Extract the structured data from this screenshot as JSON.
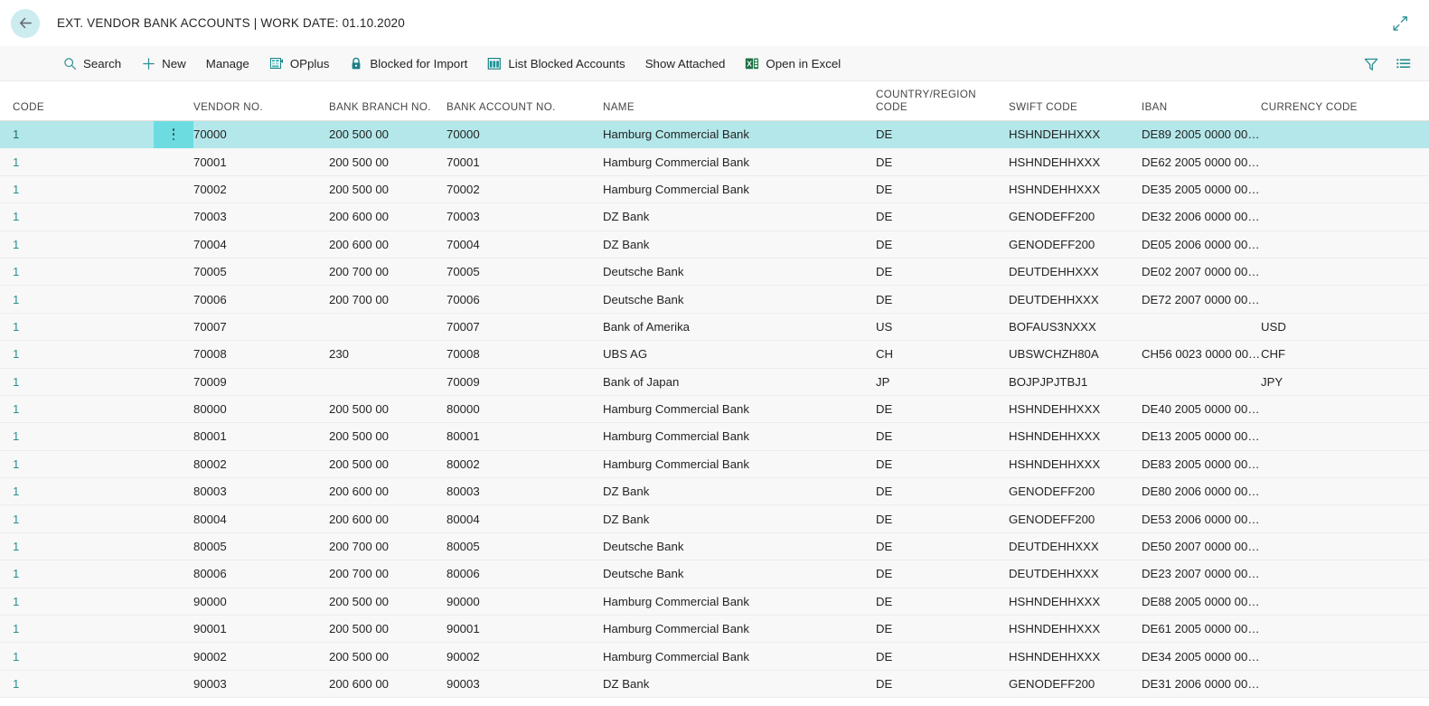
{
  "window": {
    "title": "EXT. VENDOR BANK ACCOUNTS | WORK DATE: 01.10.2020",
    "back_label": "Back",
    "expand_label": "Expand"
  },
  "colors": {
    "accent": "#2d8f92",
    "selected_row": "#b3e7ea",
    "selected_menu": "#6ddce0",
    "row_bg": "#f8f8f8",
    "cmdbar_bg": "#f8f8f8",
    "back_circle": "#ccecef"
  },
  "toolbar": {
    "items": [
      {
        "label": "Search",
        "icon": "search-icon"
      },
      {
        "label": "New",
        "icon": "plus-icon"
      },
      {
        "label": "Manage",
        "icon": "none"
      },
      {
        "label": "OPplus",
        "icon": "opplus-icon"
      },
      {
        "label": "Blocked for Import",
        "icon": "lock-icon"
      },
      {
        "label": "List Blocked Accounts",
        "icon": "table-icon"
      },
      {
        "label": "Show Attached",
        "icon": "none"
      },
      {
        "label": "Open in Excel",
        "icon": "excel-icon"
      }
    ],
    "right_icons": [
      {
        "name": "filter-icon",
        "label": "Filter"
      },
      {
        "name": "list-options-icon",
        "label": "Options"
      }
    ]
  },
  "grid": {
    "columns": [
      {
        "key": "code",
        "label": "CODE"
      },
      {
        "key": "vendor",
        "label": "VENDOR NO."
      },
      {
        "key": "branch",
        "label": "BANK BRANCH NO."
      },
      {
        "key": "acct",
        "label": "BANK ACCOUNT NO."
      },
      {
        "key": "name",
        "label": "NAME"
      },
      {
        "key": "country",
        "label": "COUNTRY/REGION\nCODE"
      },
      {
        "key": "swift",
        "label": "SWIFT CODE"
      },
      {
        "key": "iban",
        "label": "IBAN"
      },
      {
        "key": "curr",
        "label": "CURRENCY CODE"
      }
    ],
    "selected_index": 0,
    "rows": [
      {
        "code": "1",
        "vendor": "70000",
        "branch": "200 500 00",
        "acct": "70000",
        "name": "Hamburg Commercial Bank",
        "country": "DE",
        "swift": "HSHNDEHHXXX",
        "iban": "DE89 2005 0000 00…",
        "curr": ""
      },
      {
        "code": "1",
        "vendor": "70001",
        "branch": "200 500 00",
        "acct": "70001",
        "name": "Hamburg Commercial Bank",
        "country": "DE",
        "swift": "HSHNDEHHXXX",
        "iban": "DE62 2005 0000 00…",
        "curr": ""
      },
      {
        "code": "1",
        "vendor": "70002",
        "branch": "200 500 00",
        "acct": "70002",
        "name": "Hamburg Commercial Bank",
        "country": "DE",
        "swift": "HSHNDEHHXXX",
        "iban": "DE35 2005 0000 00…",
        "curr": ""
      },
      {
        "code": "1",
        "vendor": "70003",
        "branch": "200 600 00",
        "acct": "70003",
        "name": "DZ Bank",
        "country": "DE",
        "swift": "GENODEFF200",
        "iban": "DE32 2006 0000 00…",
        "curr": ""
      },
      {
        "code": "1",
        "vendor": "70004",
        "branch": "200 600 00",
        "acct": "70004",
        "name": "DZ Bank",
        "country": "DE",
        "swift": "GENODEFF200",
        "iban": "DE05 2006 0000 00…",
        "curr": ""
      },
      {
        "code": "1",
        "vendor": "70005",
        "branch": "200 700 00",
        "acct": "70005",
        "name": "Deutsche Bank",
        "country": "DE",
        "swift": "DEUTDEHHXXX",
        "iban": "DE02 2007 0000 00…",
        "curr": ""
      },
      {
        "code": "1",
        "vendor": "70006",
        "branch": "200 700 00",
        "acct": "70006",
        "name": "Deutsche Bank",
        "country": "DE",
        "swift": "DEUTDEHHXXX",
        "iban": "DE72 2007 0000 00…",
        "curr": ""
      },
      {
        "code": "1",
        "vendor": "70007",
        "branch": "",
        "acct": "70007",
        "name": "Bank of Amerika",
        "country": "US",
        "swift": "BOFAUS3NXXX",
        "iban": "",
        "curr": "USD"
      },
      {
        "code": "1",
        "vendor": "70008",
        "branch": "230",
        "acct": "70008",
        "name": "UBS AG",
        "country": "CH",
        "swift": "UBSWCHZH80A",
        "iban": "CH56 0023 0000 00…",
        "curr": "CHF"
      },
      {
        "code": "1",
        "vendor": "70009",
        "branch": "",
        "acct": "70009",
        "name": "Bank of Japan",
        "country": "JP",
        "swift": "BOJPJPJTBJ1",
        "iban": "",
        "curr": "JPY"
      },
      {
        "code": "1",
        "vendor": "80000",
        "branch": "200 500 00",
        "acct": "80000",
        "name": "Hamburg Commercial Bank",
        "country": "DE",
        "swift": "HSHNDEHHXXX",
        "iban": "DE40 2005 0000 00…",
        "curr": ""
      },
      {
        "code": "1",
        "vendor": "80001",
        "branch": "200 500 00",
        "acct": "80001",
        "name": "Hamburg Commercial Bank",
        "country": "DE",
        "swift": "HSHNDEHHXXX",
        "iban": "DE13 2005 0000 00…",
        "curr": ""
      },
      {
        "code": "1",
        "vendor": "80002",
        "branch": "200 500 00",
        "acct": "80002",
        "name": "Hamburg Commercial Bank",
        "country": "DE",
        "swift": "HSHNDEHHXXX",
        "iban": "DE83 2005 0000 00…",
        "curr": ""
      },
      {
        "code": "1",
        "vendor": "80003",
        "branch": "200 600 00",
        "acct": "80003",
        "name": "DZ Bank",
        "country": "DE",
        "swift": "GENODEFF200",
        "iban": "DE80 2006 0000 00…",
        "curr": ""
      },
      {
        "code": "1",
        "vendor": "80004",
        "branch": "200 600 00",
        "acct": "80004",
        "name": "DZ Bank",
        "country": "DE",
        "swift": "GENODEFF200",
        "iban": "DE53 2006 0000 00…",
        "curr": ""
      },
      {
        "code": "1",
        "vendor": "80005",
        "branch": "200 700 00",
        "acct": "80005",
        "name": "Deutsche Bank",
        "country": "DE",
        "swift": "DEUTDEHHXXX",
        "iban": "DE50 2007 0000 00…",
        "curr": ""
      },
      {
        "code": "1",
        "vendor": "80006",
        "branch": "200 700 00",
        "acct": "80006",
        "name": "Deutsche Bank",
        "country": "DE",
        "swift": "DEUTDEHHXXX",
        "iban": "DE23 2007 0000 00…",
        "curr": ""
      },
      {
        "code": "1",
        "vendor": "90000",
        "branch": "200 500 00",
        "acct": "90000",
        "name": "Hamburg Commercial Bank",
        "country": "DE",
        "swift": "HSHNDEHHXXX",
        "iban": "DE88 2005 0000 00…",
        "curr": ""
      },
      {
        "code": "1",
        "vendor": "90001",
        "branch": "200 500 00",
        "acct": "90001",
        "name": "Hamburg Commercial Bank",
        "country": "DE",
        "swift": "HSHNDEHHXXX",
        "iban": "DE61 2005 0000 00…",
        "curr": ""
      },
      {
        "code": "1",
        "vendor": "90002",
        "branch": "200 500 00",
        "acct": "90002",
        "name": "Hamburg Commercial Bank",
        "country": "DE",
        "swift": "HSHNDEHHXXX",
        "iban": "DE34 2005 0000 00…",
        "curr": ""
      },
      {
        "code": "1",
        "vendor": "90003",
        "branch": "200 600 00",
        "acct": "90003",
        "name": "DZ Bank",
        "country": "DE",
        "swift": "GENODEFF200",
        "iban": "DE31 2006 0000 00…",
        "curr": ""
      }
    ]
  }
}
